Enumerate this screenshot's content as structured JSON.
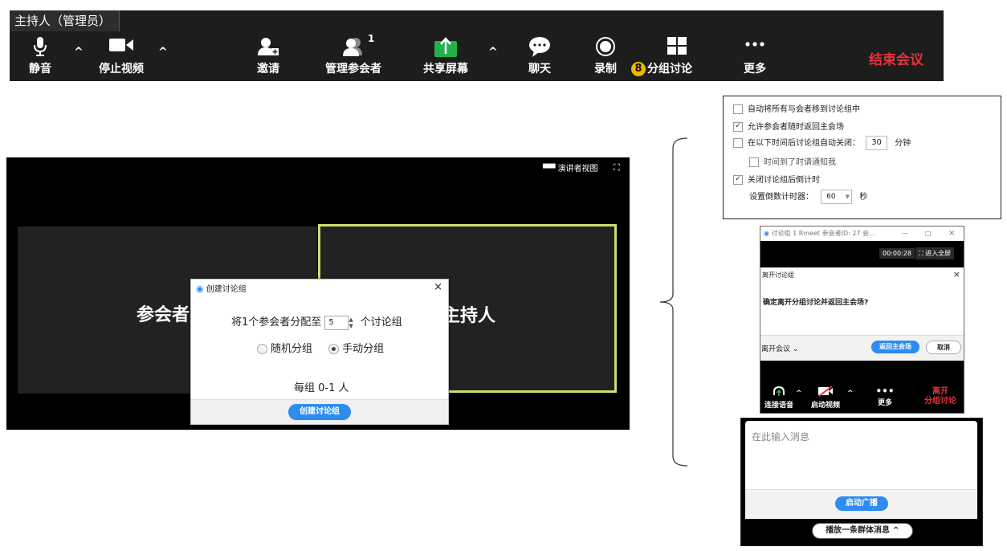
{
  "toolbar": {
    "host_tab": "主持人（管理员）",
    "mute": "静音",
    "stop_video": "停止视频",
    "invite": "邀请",
    "manage_participants": "管理参会者",
    "participant_count": "1",
    "share_screen": "共享屏幕",
    "chat": "聊天",
    "record": "录制",
    "step_number": "8",
    "breakout_rooms": "分组讨论",
    "more": "更多",
    "end_meeting": "结束会议",
    "caret": "^"
  },
  "video": {
    "speaker_view": "演讲者视图",
    "participant_tile": "参会者",
    "host_tile": "主持人"
  },
  "create_dialog": {
    "title": "创建讨论组",
    "close": "×",
    "assign_prefix": "将1个参会者分配至",
    "room_count": "5",
    "assign_suffix": "个讨论组",
    "auto_assign": "随机分组",
    "manual_assign": "手动分组",
    "per_room": "每组 0-1 人",
    "create_button": "创建讨论组"
  },
  "options": {
    "opt1": "自动将所有与会者移到讨论组中",
    "opt2": "允许参会者随时返回主会场",
    "opt3_prefix": "在以下时间后讨论组自动关闭：",
    "opt3_value": "30",
    "opt3_unit": "分钟",
    "opt3_sub": "时间到了时请通知我",
    "opt4": "关闭讨论组后倒计时",
    "countdown_label": "设置倒数计时器：",
    "countdown_value": "60",
    "countdown_unit": "秒",
    "opt1_checked": false,
    "opt2_checked": true,
    "opt3_checked": false,
    "opt3_sub_checked": false,
    "opt4_checked": true
  },
  "breakout_window": {
    "title": "讨论组 1   Rmeet 参会者ID: 27  会...",
    "minimize": "—",
    "maximize": "□",
    "close": "×",
    "timer": "00:00:28",
    "fullscreen": "进入全屏",
    "leave_title": "离开讨论组",
    "leave_close": "×",
    "leave_question": "确定离开分组讨论并返回主会场?",
    "leave_meeting": "离开会议 ⌄",
    "return_main": "返回主会场",
    "cancel": "取消",
    "connect_audio": "连接语音",
    "start_video": "启动视频",
    "more": "更多",
    "leave_breakout_1": "离开",
    "leave_breakout_2": "分组讨论"
  },
  "broadcast": {
    "placeholder": "在此输入消息",
    "start_button": "启动广播",
    "broadcast_pill": "播放一条群体消息 ^"
  }
}
